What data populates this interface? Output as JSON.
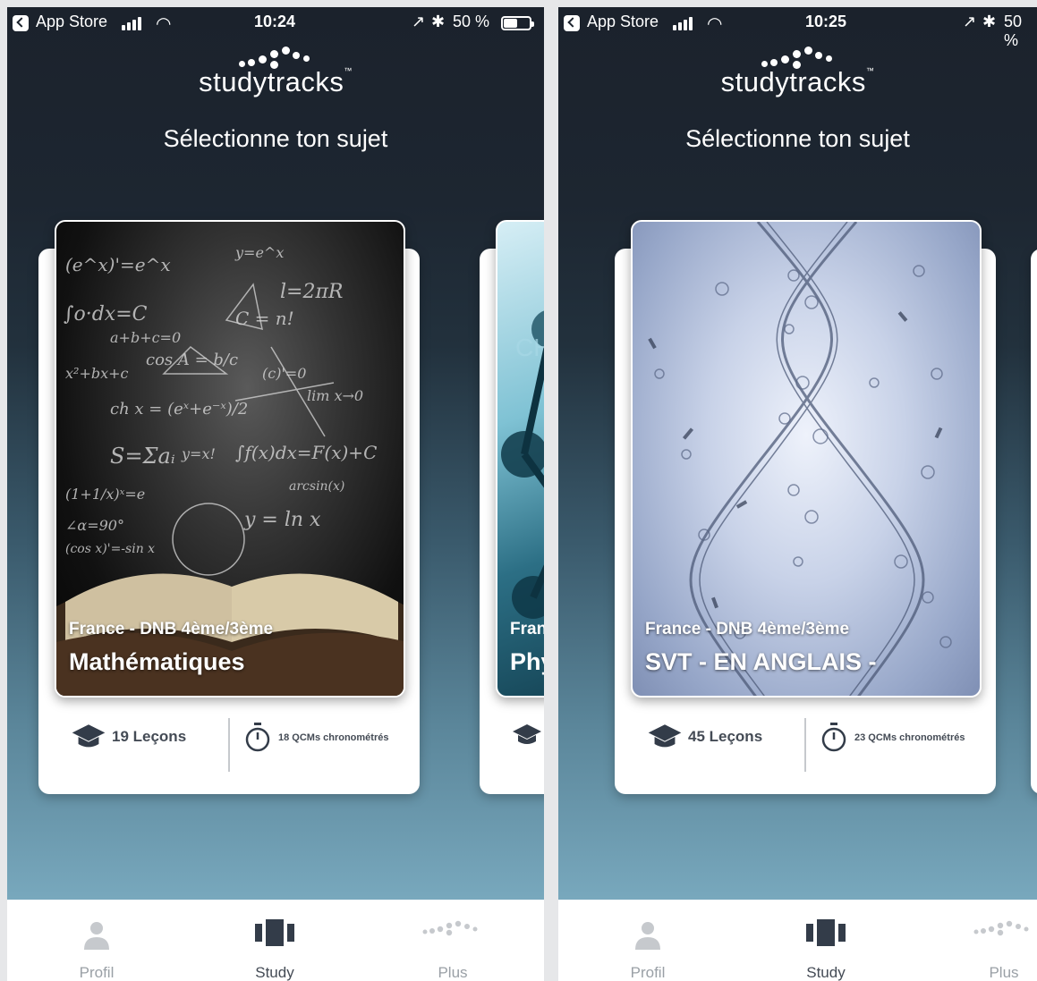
{
  "screens": [
    {
      "status": {
        "carrier": "App Store",
        "time": "10:24",
        "battery": "50 %",
        "battery_fill": 0.5
      },
      "brand": "studytracks",
      "heading": "Sélectionne ton sujet",
      "card": {
        "subtitle": "France - DNB 4ème/3ème",
        "title": "Mathématiques",
        "lessons": "19 Leçons",
        "qcm": "18 QCMs chronométrés"
      },
      "peek_card": {
        "subtitle": "Fran",
        "title": "Phy"
      },
      "tabs": [
        {
          "label": "Profil",
          "icon": "user-icon"
        },
        {
          "label": "Study",
          "icon": "cards-icon"
        },
        {
          "label": "Plus",
          "icon": "dots-logo-icon"
        }
      ]
    },
    {
      "status": {
        "carrier": "App Store",
        "time": "10:25",
        "battery": "50 %",
        "battery_fill": 0.5
      },
      "brand": "studytracks",
      "heading": "Sélectionne ton sujet",
      "card": {
        "subtitle": "France - DNB 4ème/3ème",
        "title": "SVT - EN ANGLAIS -",
        "lessons": "45 Leçons",
        "qcm": "23 QCMs chronométrés"
      },
      "tabs": [
        {
          "label": "Profil",
          "icon": "user-icon"
        },
        {
          "label": "Study",
          "icon": "cards-icon"
        },
        {
          "label": "Plus",
          "icon": "dots-logo-icon"
        }
      ]
    }
  ]
}
